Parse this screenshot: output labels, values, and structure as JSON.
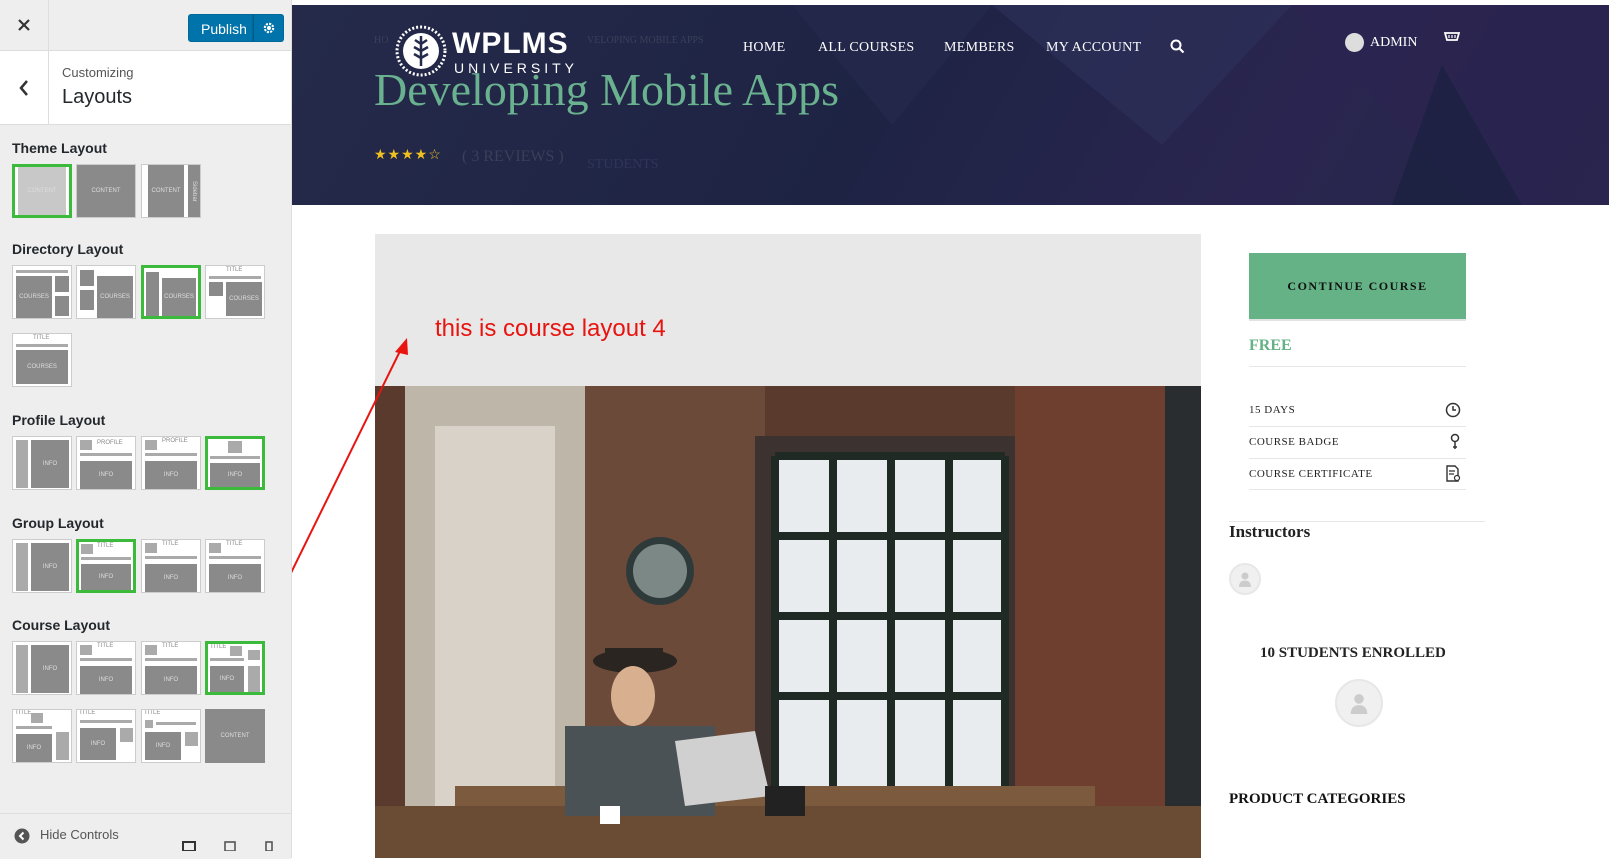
{
  "customizer": {
    "publish_label": "Publish",
    "customizing_label": "Customizing",
    "section_title": "Layouts",
    "hide_controls_label": "Hide Controls",
    "groups": {
      "theme": "Theme Layout",
      "directory": "Directory Layout",
      "profile": "Profile Layout",
      "group": "Group Layout",
      "course": "Course Layout"
    },
    "thumb_labels": {
      "content": "CONTENT",
      "sidebar": "Sidebar",
      "courses": "COURSES",
      "title": "TITLE",
      "info": "INFO",
      "profile": "PROFILE"
    },
    "accent": "#3cba3c"
  },
  "site": {
    "logo": "WPLMS",
    "logo_sub": "UNIVERSITY",
    "nav": [
      "HOME",
      "ALL COURSES",
      "MEMBERS",
      "MY ACCOUNT"
    ],
    "admin_label": "ADMIN",
    "breadcrumb_start": "HO",
    "breadcrumb_end": "VELOPING MOBILE APPS"
  },
  "course": {
    "title": "Developing Mobile Apps",
    "rating_stars": "★★★★☆",
    "rating": 4.5,
    "reviews": "( 3 REVIEWS )",
    "students_label": "STUDENTS",
    "continue_label": "CONTINUE COURSE",
    "price": "FREE",
    "details": [
      {
        "label": "15 DAYS",
        "icon": "clock-icon"
      },
      {
        "label": "COURSE BADGE",
        "icon": "badge-icon"
      },
      {
        "label": "COURSE CERTIFICATE",
        "icon": "certificate-icon"
      }
    ],
    "instructors_heading": "Instructors",
    "enrolled_label": "10 STUDENTS ENROLLED",
    "product_categories": "PRODUCT CATEGORIES",
    "annotation": "this is course layout 4",
    "annotation_color": "#e8140f",
    "title_color": "#6ab190",
    "button_color": "#64b285"
  }
}
